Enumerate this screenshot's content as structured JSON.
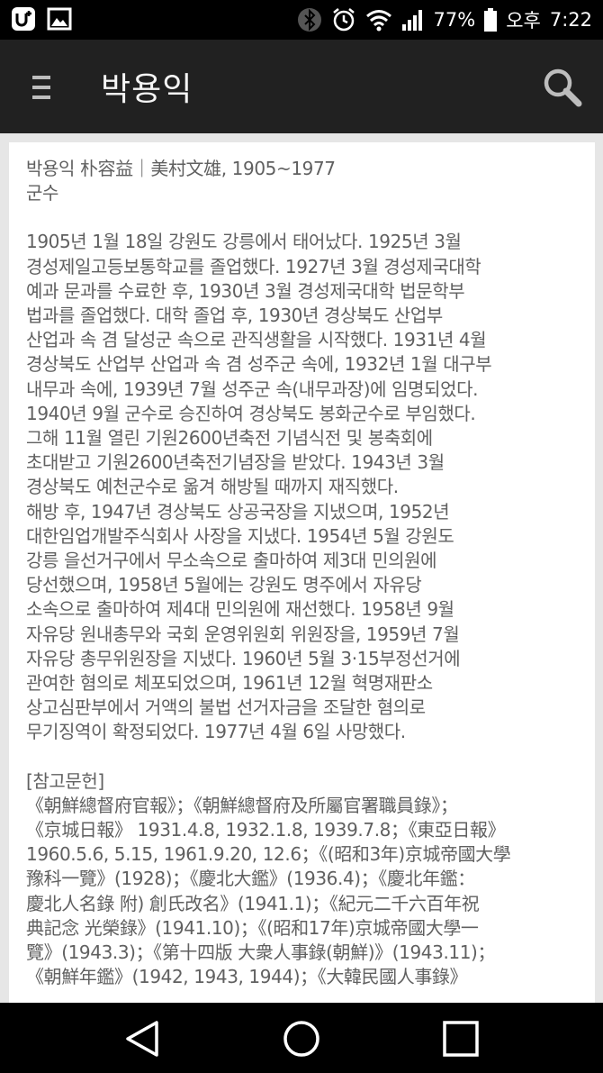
{
  "status_bar": {
    "left_icons": [
      "u-plus-icon",
      "image-icon"
    ],
    "battery": "77%",
    "ampm": "오후",
    "time": "7:22"
  },
  "app_bar": {
    "title": "박용익"
  },
  "article": {
    "header_lines": [
      "박용익 朴容益｜美村文雄, 1905~1977",
      "군수"
    ],
    "body_lines": [
      "1905년 1월 18일 강원도 강릉에서 태어났다. 1925년 3월",
      "경성제일고등보통학교를 졸업했다. 1927년 3월 경성제국대학",
      "예과 문과를 수료한 후, 1930년 3월 경성제국대학 법문학부",
      "법과를 졸업했다. 대학 졸업 후, 1930년 경상북도 산업부",
      "산업과 속 겸 달성군 속으로 관직생활을 시작했다. 1931년 4월",
      "경상북도 산업부 산업과 속 겸 성주군 속에, 1932년 1월 대구부",
      "내무과 속에, 1939년 7월 성주군 속(내무과장)에 임명되었다.",
      "1940년 9월 군수로 승진하여 경상북도 봉화군수로 부임했다.",
      "그해 11월 열린 기원2600년축전 기념식전 및 봉축회에",
      "초대받고 기원2600년축전기념장을 받았다. 1943년 3월",
      "경상북도 예천군수로 옮겨 해방될 때까지 재직했다.",
      "해방 후, 1947년 경상북도 상공국장을 지냈으며, 1952년",
      "대한임업개발주식회사 사장을 지냈다. 1954년 5월 강원도",
      "강릉 을선거구에서 무소속으로 출마하여 제3대 민의원에",
      "당선했으며, 1958년 5월에는 강원도 명주에서 자유당",
      "소속으로 출마하여 제4대 민의원에 재선했다. 1958년 9월",
      "자유당 원내총무와 국회 운영위원회 위원장을, 1959년 7월",
      "자유당 총무위원장을 지냈다. 1960년 5월 3·15부정선거에",
      "관여한 혐의로 체포되었으며, 1961년 12월 혁명재판소",
      "상고심판부에서 거액의 불법 선거자금을 조달한 혐의로",
      "무기징역이 확정되었다. 1977년 4월 6일 사망했다."
    ],
    "references_heading": "[참고문헌]",
    "reference_lines": [
      "《朝鮮總督府官報》；《朝鮮總督府及所屬官署職員錄》；",
      "《京城日報》 1931.4.8, 1932.1.8, 1939.7.8；《東亞日報》",
      "1960.5.6, 5.15, 1961.9.20, 12.6；《(昭和3年)京城帝國大學",
      "豫科一覽》(1928)；《慶北大鑑》(1936.4)；《慶北年鑑：",
      "慶北人名錄 附) 創氏改名》(1941.1)；《紀元二千六百年祝",
      "典記念 光榮錄》(1941.10)；《(昭和17年)京城帝國大學一",
      "覽》(1943.3)；《第十四版 大衆人事錄(朝鮮)》(1943.11)；",
      "《朝鮮年鑑》(1942, 1943, 1944)；《大韓民國人事錄》"
    ]
  },
  "nav_bar": {
    "buttons": [
      "back-icon",
      "home-icon",
      "recents-icon"
    ]
  }
}
